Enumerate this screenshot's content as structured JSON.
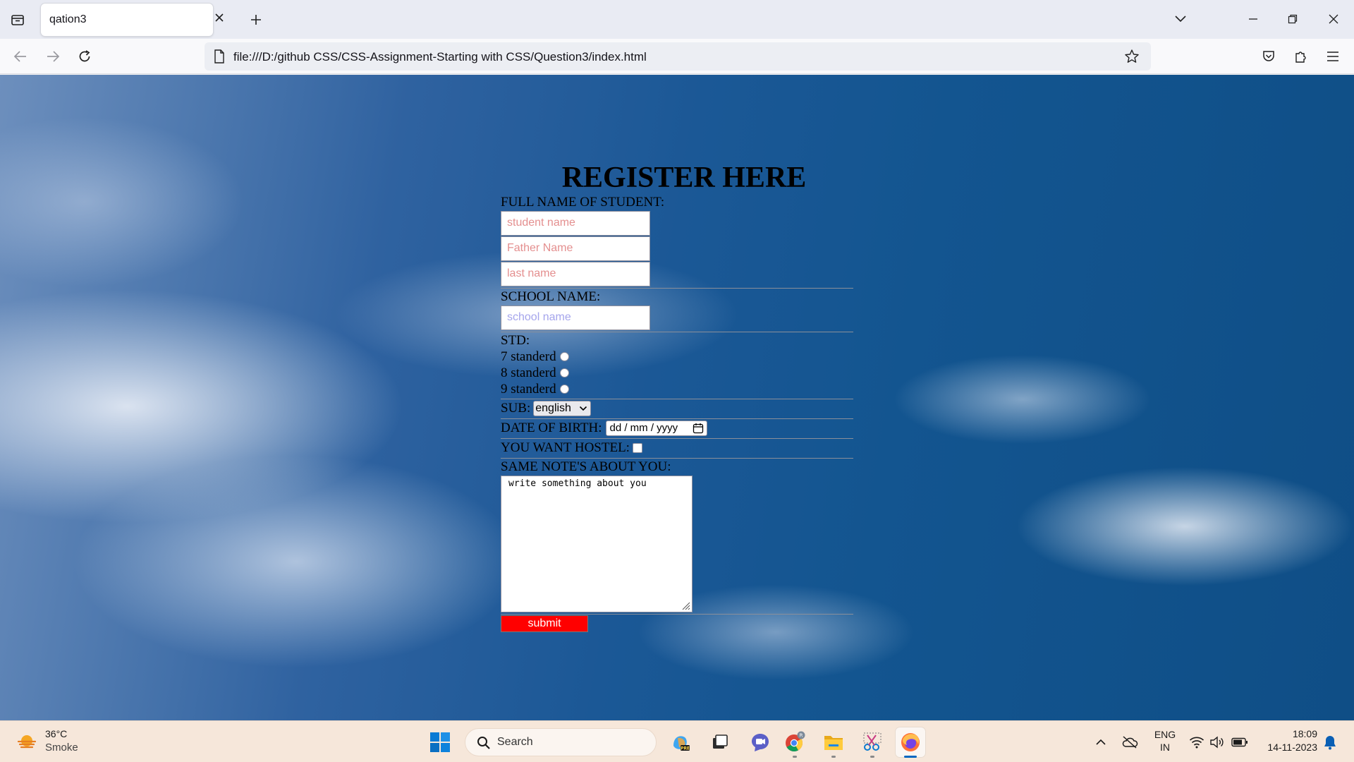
{
  "browser": {
    "tab_title": "qation3",
    "url": "file:///D:/github CSS/CSS-Assignment-Starting with CSS/Question3/index.html"
  },
  "form": {
    "heading": "REGISTER HERE",
    "full_name_label": "FULL NAME OF STUDENT:",
    "student_name_placeholder": "student name",
    "father_name_placeholder": "Father Name",
    "last_name_placeholder": "last name",
    "school_label": "SCHOOL NAME:",
    "school_placeholder": "school name",
    "std_label": "STD:",
    "std_options": [
      "7 standerd",
      "8 standerd",
      "9 standerd"
    ],
    "sub_label": "SUB:",
    "sub_selected": "english",
    "dob_label": "DATE OF BIRTH:",
    "dob_placeholder": "dd / mm / yyyy",
    "hostel_label": "YOU WANT HOSTEL:",
    "hostel_checked": false,
    "notes_label": "SAME NOTE'S ABOUT YOU:",
    "notes_value": "write something about you",
    "submit_label": "submit"
  },
  "taskbar": {
    "weather_temp": "36°C",
    "weather_desc": "Smoke",
    "search_label": "Search",
    "lang_line1": "ENG",
    "lang_line2": "IN",
    "time": "18:09",
    "date": "14-11-2023"
  },
  "colors": {
    "submit_bg": "#ff0000",
    "taskbar_bg": "#f6e7da",
    "firefox_accent": "#ff7139"
  }
}
